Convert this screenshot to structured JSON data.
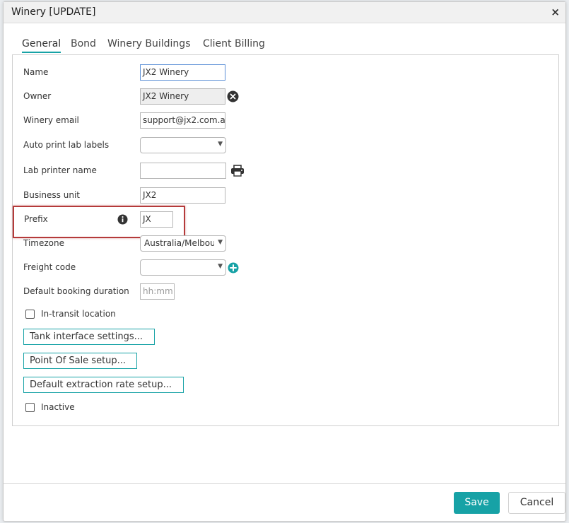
{
  "dialog": {
    "title": "Winery [UPDATE]",
    "close_label": "×"
  },
  "tabs": [
    {
      "label": "General",
      "active": true
    },
    {
      "label": "Bond",
      "active": false
    },
    {
      "label": "Winery Buildings",
      "active": false
    },
    {
      "label": "Client Billing",
      "active": false
    }
  ],
  "form": {
    "name": {
      "label": "Name",
      "value": "JX2 Winery"
    },
    "owner": {
      "label": "Owner",
      "value": "JX2 Winery"
    },
    "winery_email": {
      "label": "Winery email",
      "value": "support@jx2.com.a"
    },
    "auto_print_lab_labels": {
      "label": "Auto print lab labels",
      "value": ""
    },
    "lab_printer_name": {
      "label": "Lab printer name",
      "value": ""
    },
    "business_unit": {
      "label": "Business unit",
      "value": "JX2"
    },
    "prefix": {
      "label": "Prefix",
      "value": "JX"
    },
    "timezone": {
      "label": "Timezone",
      "value": "Australia/Melbou"
    },
    "freight_code": {
      "label": "Freight code",
      "value": ""
    },
    "default_booking_duration": {
      "label": "Default booking duration",
      "placeholder": "hh:mm"
    },
    "in_transit_location": {
      "label": "In-transit location",
      "checked": false
    },
    "inactive": {
      "label": "Inactive",
      "checked": false
    }
  },
  "buttons": {
    "tank_interface": "Tank interface settings...",
    "point_of_sale": "Point Of Sale setup...",
    "default_extraction": "Default extraction rate setup...",
    "save": "Save",
    "cancel": "Cancel"
  },
  "icons": {
    "clear_owner": "clear-circle-icon",
    "printer": "printer-icon",
    "info": "info-icon",
    "add_freight": "plus-circle-icon",
    "dropdown": "chevron-down-icon"
  },
  "colors": {
    "accent": "#17a2a6",
    "highlight_border": "#b53a3a",
    "focus_border": "#5b8fd6"
  }
}
